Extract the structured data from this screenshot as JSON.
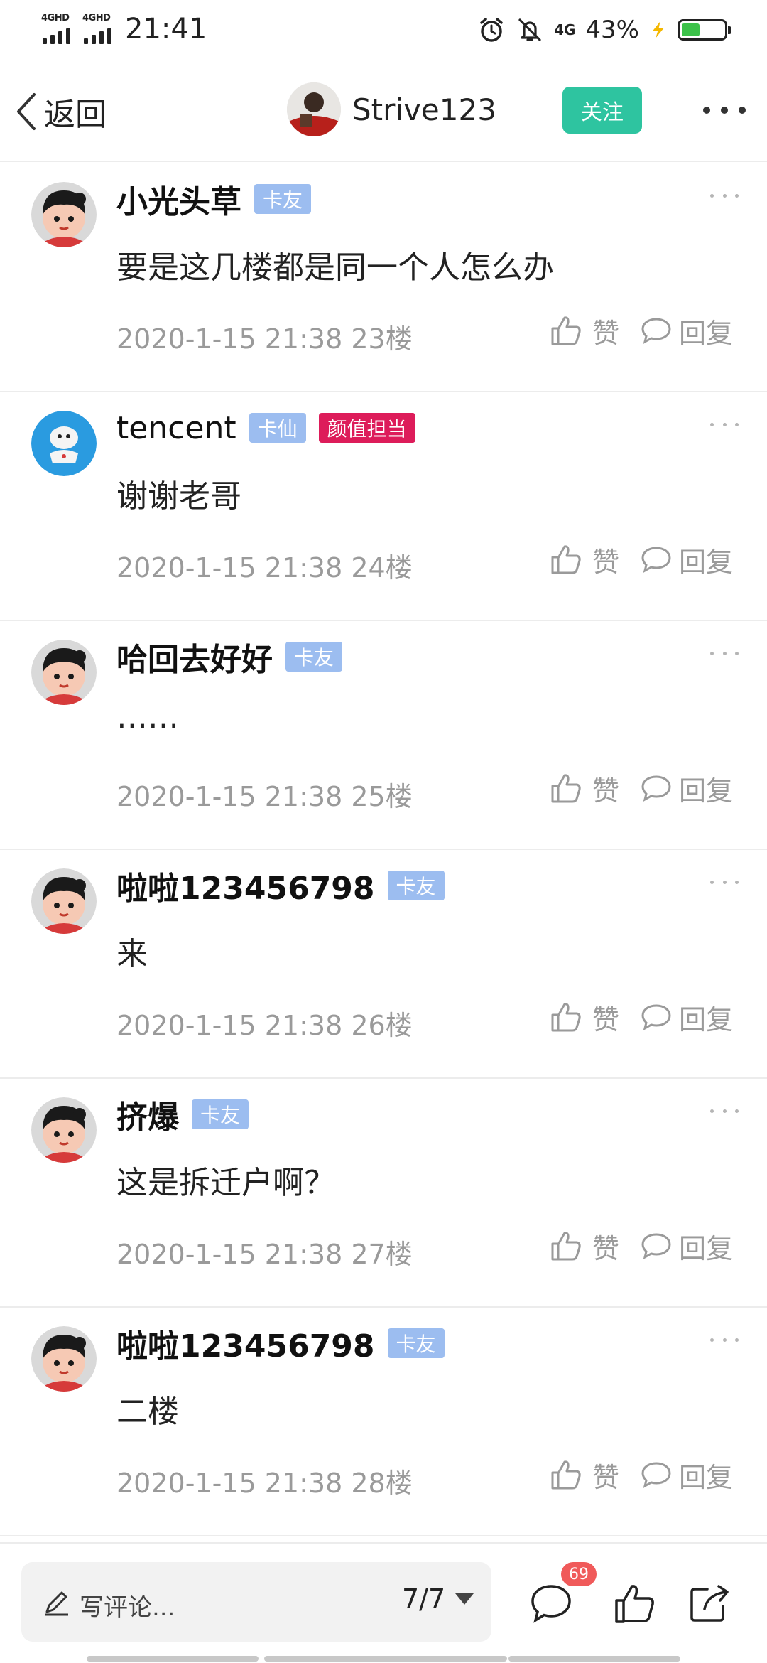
{
  "status_bar": {
    "sim1": "4GHD",
    "sim2": "4GHD",
    "time": "21:41",
    "network": "4G",
    "battery_percent": "43%",
    "battery_level": 0.43,
    "icons": [
      "alarm-icon",
      "mute-icon",
      "charging-icon"
    ]
  },
  "header": {
    "back_label": "返回",
    "author_name": "Strive123",
    "follow_label": "关注"
  },
  "comments": [
    {
      "name": "小光头草",
      "badges": [
        "卡友"
      ],
      "text": "要是这几楼都是同一个人怎么办",
      "date": "2020-1-15 21:38",
      "floor": "23楼",
      "like_label": "赞",
      "reply_label": "回复"
    },
    {
      "name": "tencent",
      "badges": [
        "卡仙",
        "颜值担当"
      ],
      "text": "谢谢老哥",
      "date": "2020-1-15 21:38",
      "floor": "24楼",
      "like_label": "赞",
      "reply_label": "回复"
    },
    {
      "name": "哈回去好好",
      "badges": [
        "卡友"
      ],
      "text": "……",
      "date": "2020-1-15 21:38",
      "floor": "25楼",
      "like_label": "赞",
      "reply_label": "回复"
    },
    {
      "name": "啦啦123456798",
      "badges": [
        "卡友"
      ],
      "text": "来",
      "date": "2020-1-15 21:38",
      "floor": "26楼",
      "like_label": "赞",
      "reply_label": "回复"
    },
    {
      "name": "挤爆",
      "badges": [
        "卡友"
      ],
      "text": "这是拆迁户啊？",
      "date": "2020-1-15 21:38",
      "floor": "27楼",
      "like_label": "赞",
      "reply_label": "回复"
    },
    {
      "name": "啦啦123456798",
      "badges": [
        "卡友"
      ],
      "text": "二楼",
      "date": "2020-1-15 21:38",
      "floor": "28楼",
      "like_label": "赞",
      "reply_label": "回复"
    }
  ],
  "bottom_bar": {
    "placeholder": "写评论...",
    "page": "7/7",
    "comment_count": "69"
  },
  "colors": {
    "follow": "#2ec4a0",
    "badge_blue": "#9cbdf0",
    "badge_pink": "#dd1c5a",
    "count_badge": "#f05a5a",
    "battery": "#3cc24a"
  }
}
